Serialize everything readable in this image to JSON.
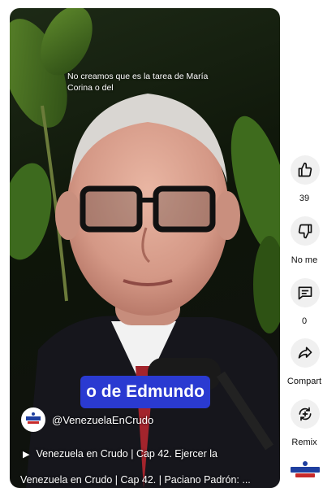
{
  "video": {
    "top_caption": "No creamos que es la tarea de María Corina o del",
    "subtitle": "o de Edmundo",
    "channel": {
      "avatar_icon": "venezuela-en-crudo-logo",
      "handle": "@VenezuelaEnCrudo"
    },
    "playlist": {
      "icon": "play-icon",
      "label": "Venezuela en Crudo | Cap 42. Ejercer la"
    },
    "title": "Venezuela en Crudo | Cap 42. | Paciano Padrón: ..."
  },
  "actions": [
    {
      "icon": "thumbs-up-icon",
      "label": "39"
    },
    {
      "icon": "thumbs-down-icon",
      "label": "No me"
    },
    {
      "icon": "comment-icon",
      "label": "0"
    },
    {
      "icon": "share-icon",
      "label": "Compart"
    },
    {
      "icon": "remix-icon",
      "label": "Remix"
    }
  ],
  "colors": {
    "subtitle_background": "#2a3ad1",
    "action_button_background": "#f0f0f0",
    "brand_blue": "#1f3f9f"
  }
}
